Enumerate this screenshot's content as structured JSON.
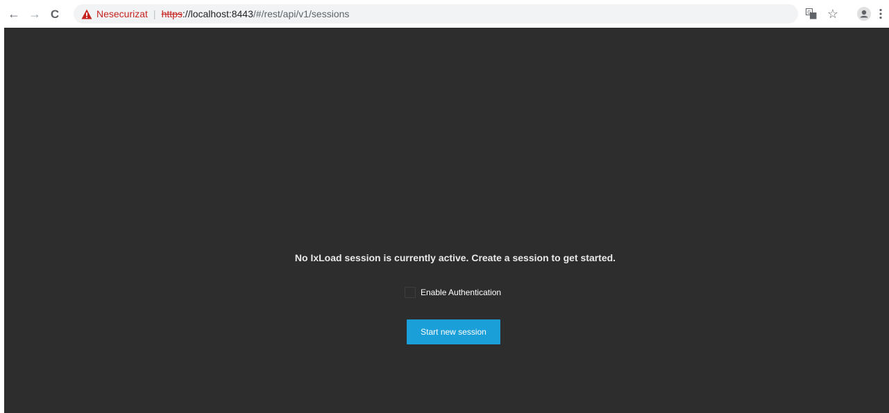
{
  "browser": {
    "nav": {
      "back_glyph": "←",
      "forward_glyph": "→",
      "reload_glyph": "C"
    },
    "security_label": "Nesecurizat",
    "url": {
      "scheme": "https",
      "host": "://localhost:8443",
      "path": "/#/rest/api/v1/sessions"
    },
    "icons": [
      "back-arrow-icon",
      "forward-arrow-icon",
      "reload-icon",
      "warning-icon",
      "translate-icon",
      "bookmark-star-icon",
      "profile-icon",
      "more-menu-icon"
    ]
  },
  "page": {
    "message": "No IxLoad session is currently active. Create a session to get started.",
    "auth_checkbox": {
      "label": "Enable Authentication",
      "checked": false
    },
    "start_button_label": "Start new session"
  },
  "colors": {
    "background": "#2d2d2d",
    "accent_button": "#1b9fd9",
    "insecure_red": "#c5221f"
  }
}
